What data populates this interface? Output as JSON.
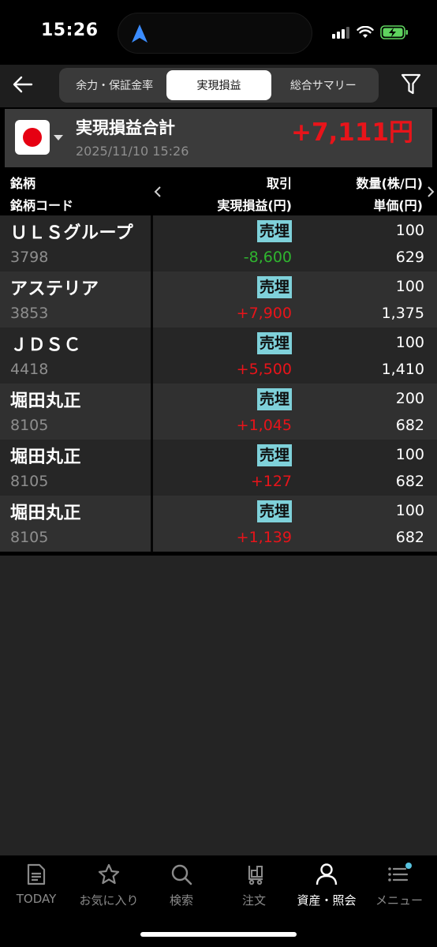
{
  "status": {
    "time": "15:26"
  },
  "header": {
    "tabs": [
      {
        "label": "余力・保証金率"
      },
      {
        "label": "実現損益"
      },
      {
        "label": "総合サマリー"
      }
    ],
    "active_tab": 1
  },
  "summary": {
    "title": "実現損益合計",
    "datetime": "2025/11/10 15:26",
    "total": "+7,111円",
    "total_color": "#e8141a"
  },
  "columns": {
    "name": "銘柄",
    "code": "銘柄コード",
    "trade": "取引",
    "pnl": "実現損益(円)",
    "qty": "数量(株/口)",
    "price": "単価(円)"
  },
  "rows": [
    {
      "name": "ＵＬＳグループ",
      "code": "3798",
      "trade": "売埋",
      "pnl": "-8,600",
      "qty": "100",
      "price": "629"
    },
    {
      "name": "アステリア",
      "code": "3853",
      "trade": "売埋",
      "pnl": "+7,900",
      "qty": "100",
      "price": "1,375"
    },
    {
      "name": "ＪＤＳＣ",
      "code": "4418",
      "trade": "売埋",
      "pnl": "+5,500",
      "qty": "100",
      "price": "1,410"
    },
    {
      "name": "堀田丸正",
      "code": "8105",
      "trade": "売埋",
      "pnl": "+1,045",
      "qty": "200",
      "price": "682"
    },
    {
      "name": "堀田丸正",
      "code": "8105",
      "trade": "売埋",
      "pnl": "+127",
      "qty": "100",
      "price": "682"
    },
    {
      "name": "堀田丸正",
      "code": "8105",
      "trade": "売埋",
      "pnl": "+1,139",
      "qty": "100",
      "price": "682"
    }
  ],
  "tabbar": {
    "items": [
      {
        "label": "TODAY",
        "icon": "document-icon"
      },
      {
        "label": "お気に入り",
        "icon": "star-icon"
      },
      {
        "label": "検索",
        "icon": "search-icon"
      },
      {
        "label": "注文",
        "icon": "cart-icon"
      },
      {
        "label": "資産・照会",
        "icon": "person-icon"
      },
      {
        "label": "メニュー",
        "icon": "menu-icon"
      }
    ],
    "active_index": 4
  },
  "colors": {
    "positive": "#e8141a",
    "negative": "#2fb52f",
    "badge": "#7fd1da"
  }
}
